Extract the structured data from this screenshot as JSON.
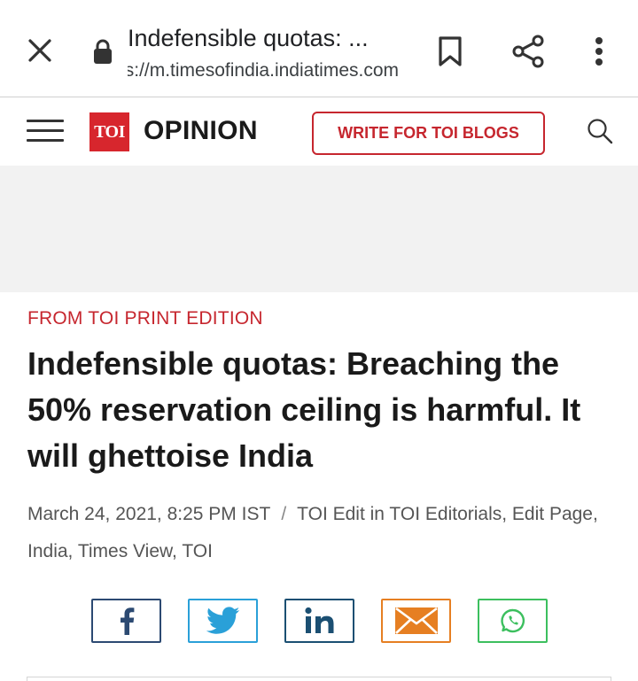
{
  "browser": {
    "title": "Indefensible quotas: ...",
    "url": "https://m.timesofindia.indiatimes.com"
  },
  "header": {
    "logo_text": "TOI",
    "section": "OPINION",
    "write_button": "WRITE FOR TOI BLOGS"
  },
  "article": {
    "kicker": "FROM TOI PRINT EDITION",
    "headline": "Indefensible quotas: Breaching the 50% reservation ceiling is harmful. It will ghettoise India",
    "date": "March 24, 2021, 8:25 PM IST",
    "separator": "/",
    "tags": "TOI Edit in TOI Editorials, Edit Page, India, Times View, TOI"
  },
  "share": {
    "buttons": [
      {
        "name": "facebook",
        "color": "#2c4a72"
      },
      {
        "name": "twitter",
        "color": "#2aa0d8"
      },
      {
        "name": "linkedin",
        "color": "#1b4f72"
      },
      {
        "name": "email",
        "color": "#e67f22"
      },
      {
        "name": "whatsapp",
        "color": "#3cbf5e"
      }
    ]
  },
  "colors": {
    "brand_red": "#d7262d",
    "kicker_red": "#c6262e"
  },
  "icons": [
    "close-icon",
    "lock-icon",
    "bookmark-icon",
    "share-icon",
    "more-vert-icon",
    "menu-icon",
    "search-icon",
    "facebook-icon",
    "twitter-icon",
    "linkedin-icon",
    "email-icon",
    "whatsapp-icon"
  ]
}
